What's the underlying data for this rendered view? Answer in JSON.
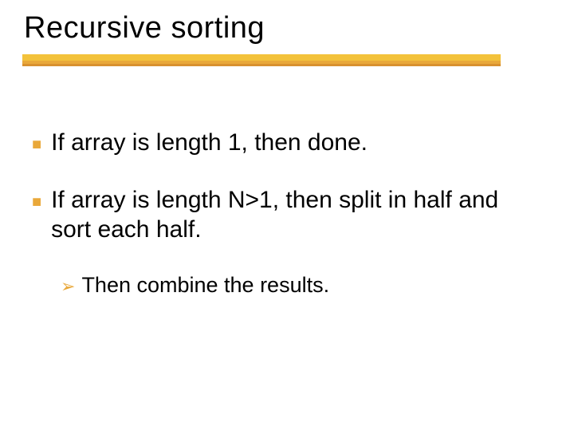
{
  "title": "Recursive sorting",
  "bullets": [
    {
      "text": "If array is length 1, then done."
    },
    {
      "text": "If array is length N>1, then split in half and sort each half.",
      "sub": [
        {
          "text": "Then combine the results."
        }
      ]
    }
  ],
  "markers": {
    "square": "■",
    "arrow": "➢"
  }
}
